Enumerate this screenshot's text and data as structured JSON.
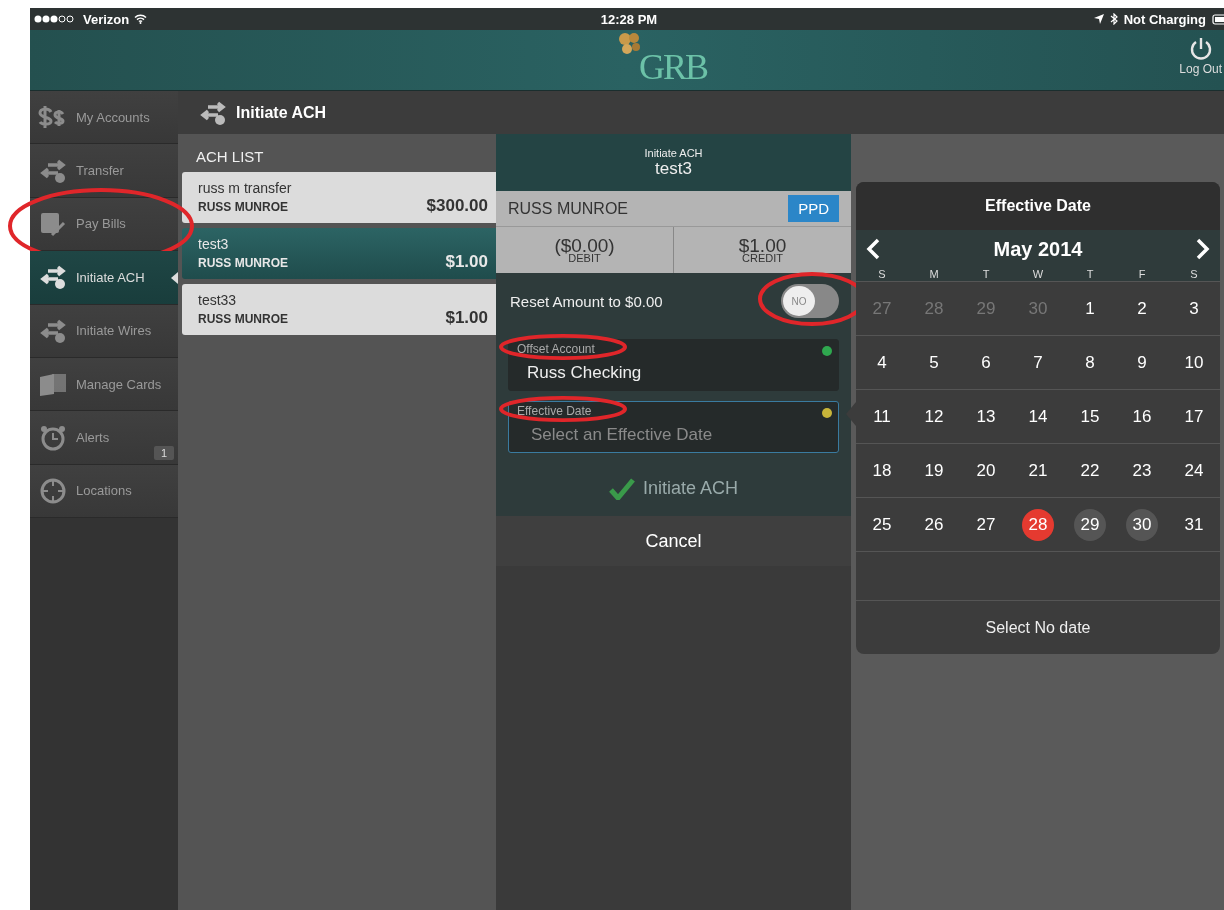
{
  "status_bar": {
    "carrier": "Verizon",
    "time": "12:28 PM",
    "battery_text": "Not Charging"
  },
  "header": {
    "logo_text": "GRB",
    "logout": "Log Out"
  },
  "sidebar": {
    "items": [
      {
        "label": "My Accounts",
        "selected": false,
        "circled": false
      },
      {
        "label": "Transfer",
        "selected": false,
        "circled": false
      },
      {
        "label": "Pay Bills",
        "selected": false,
        "circled": true
      },
      {
        "label": "Initiate ACH",
        "selected": true,
        "circled": false
      },
      {
        "label": "Initiate Wires",
        "selected": false,
        "circled": false
      },
      {
        "label": "Manage Cards",
        "selected": false,
        "circled": false
      },
      {
        "label": "Alerts",
        "selected": false,
        "circled": false,
        "badge": "1"
      },
      {
        "label": "Locations",
        "selected": false,
        "circled": false
      }
    ]
  },
  "page_title": "Initiate ACH",
  "ach_list": {
    "heading": "ACH LIST",
    "items": [
      {
        "name": "russ m transfer",
        "payee": "RUSS MUNROE",
        "amount": "$300.00",
        "selected": false
      },
      {
        "name": "test3",
        "payee": "RUSS MUNROE",
        "amount": "$1.00",
        "selected": true
      },
      {
        "name": "test33",
        "payee": "RUSS MUNROE",
        "amount": "$1.00",
        "selected": false
      }
    ]
  },
  "form": {
    "subtitle": "Initiate ACH",
    "title": "test3",
    "payee": "RUSS MUNROE",
    "type_badge": "PPD",
    "debit": {
      "amount": "($0.00)",
      "label": "DEBIT"
    },
    "credit": {
      "amount": "$1.00",
      "label": "CREDIT"
    },
    "reset": {
      "label": "Reset Amount to $0.00",
      "on": false,
      "toggle_text": "NO",
      "circled": true
    },
    "fields": [
      {
        "label": "Offset Account",
        "value": "Russ Checking",
        "color": "#2fa84f",
        "focused": false,
        "circled": true
      },
      {
        "label": "Effective Date",
        "placeholder": "Select an Effective Date",
        "color": "#c8b53a",
        "focused": true,
        "circled": true
      }
    ],
    "submit": "Initiate ACH",
    "cancel": "Cancel"
  },
  "calendar": {
    "title": "Effective Date",
    "month": "May 2014",
    "weekdays": [
      "S",
      "M",
      "T",
      "W",
      "T",
      "F",
      "S"
    ],
    "weeks": [
      [
        {
          "day": "27",
          "kind": "outside"
        },
        {
          "day": "28",
          "kind": "outside"
        },
        {
          "day": "29",
          "kind": "outside"
        },
        {
          "day": "30",
          "kind": "outside"
        },
        {
          "day": "1",
          "kind": "normal"
        },
        {
          "day": "2",
          "kind": "normal"
        },
        {
          "day": "3",
          "kind": "normal"
        }
      ],
      [
        {
          "day": "4",
          "kind": "normal"
        },
        {
          "day": "5",
          "kind": "normal"
        },
        {
          "day": "6",
          "kind": "normal"
        },
        {
          "day": "7",
          "kind": "normal"
        },
        {
          "day": "8",
          "kind": "normal"
        },
        {
          "day": "9",
          "kind": "normal"
        },
        {
          "day": "10",
          "kind": "normal"
        }
      ],
      [
        {
          "day": "11",
          "kind": "normal"
        },
        {
          "day": "12",
          "kind": "normal"
        },
        {
          "day": "13",
          "kind": "normal"
        },
        {
          "day": "14",
          "kind": "normal"
        },
        {
          "day": "15",
          "kind": "normal"
        },
        {
          "day": "16",
          "kind": "normal"
        },
        {
          "day": "17",
          "kind": "normal"
        }
      ],
      [
        {
          "day": "18",
          "kind": "normal"
        },
        {
          "day": "19",
          "kind": "normal"
        },
        {
          "day": "20",
          "kind": "normal"
        },
        {
          "day": "21",
          "kind": "normal"
        },
        {
          "day": "22",
          "kind": "normal"
        },
        {
          "day": "23",
          "kind": "normal"
        },
        {
          "day": "24",
          "kind": "normal"
        }
      ],
      [
        {
          "day": "25",
          "kind": "normal"
        },
        {
          "day": "26",
          "kind": "normal"
        },
        {
          "day": "27",
          "kind": "normal"
        },
        {
          "day": "28",
          "kind": "today"
        },
        {
          "day": "29",
          "kind": "marked"
        },
        {
          "day": "30",
          "kind": "marked"
        },
        {
          "day": "31",
          "kind": "normal"
        }
      ]
    ],
    "no_date": "Select No date"
  }
}
